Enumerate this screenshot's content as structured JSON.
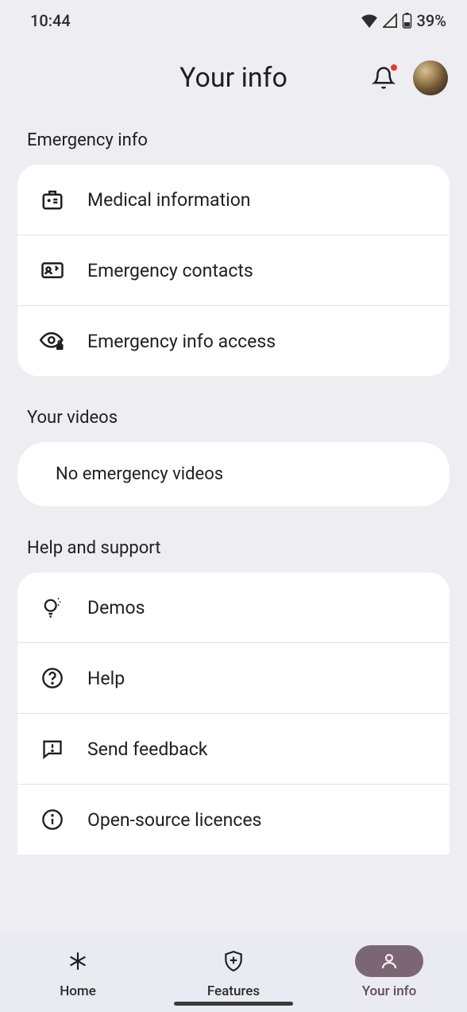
{
  "status": {
    "time": "10:44",
    "battery": "39%"
  },
  "header": {
    "title": "Your info"
  },
  "sections": {
    "emergency": {
      "title": "Emergency info",
      "items": [
        {
          "label": "Medical information"
        },
        {
          "label": "Emergency contacts"
        },
        {
          "label": "Emergency info access"
        }
      ]
    },
    "videos": {
      "title": "Your videos",
      "empty": "No emergency videos"
    },
    "help": {
      "title": "Help and support",
      "items": [
        {
          "label": "Demos"
        },
        {
          "label": "Help"
        },
        {
          "label": "Send feedback"
        },
        {
          "label": "Open-source licences"
        }
      ]
    }
  },
  "nav": {
    "home": "Home",
    "features": "Features",
    "yourinfo": "Your info"
  }
}
